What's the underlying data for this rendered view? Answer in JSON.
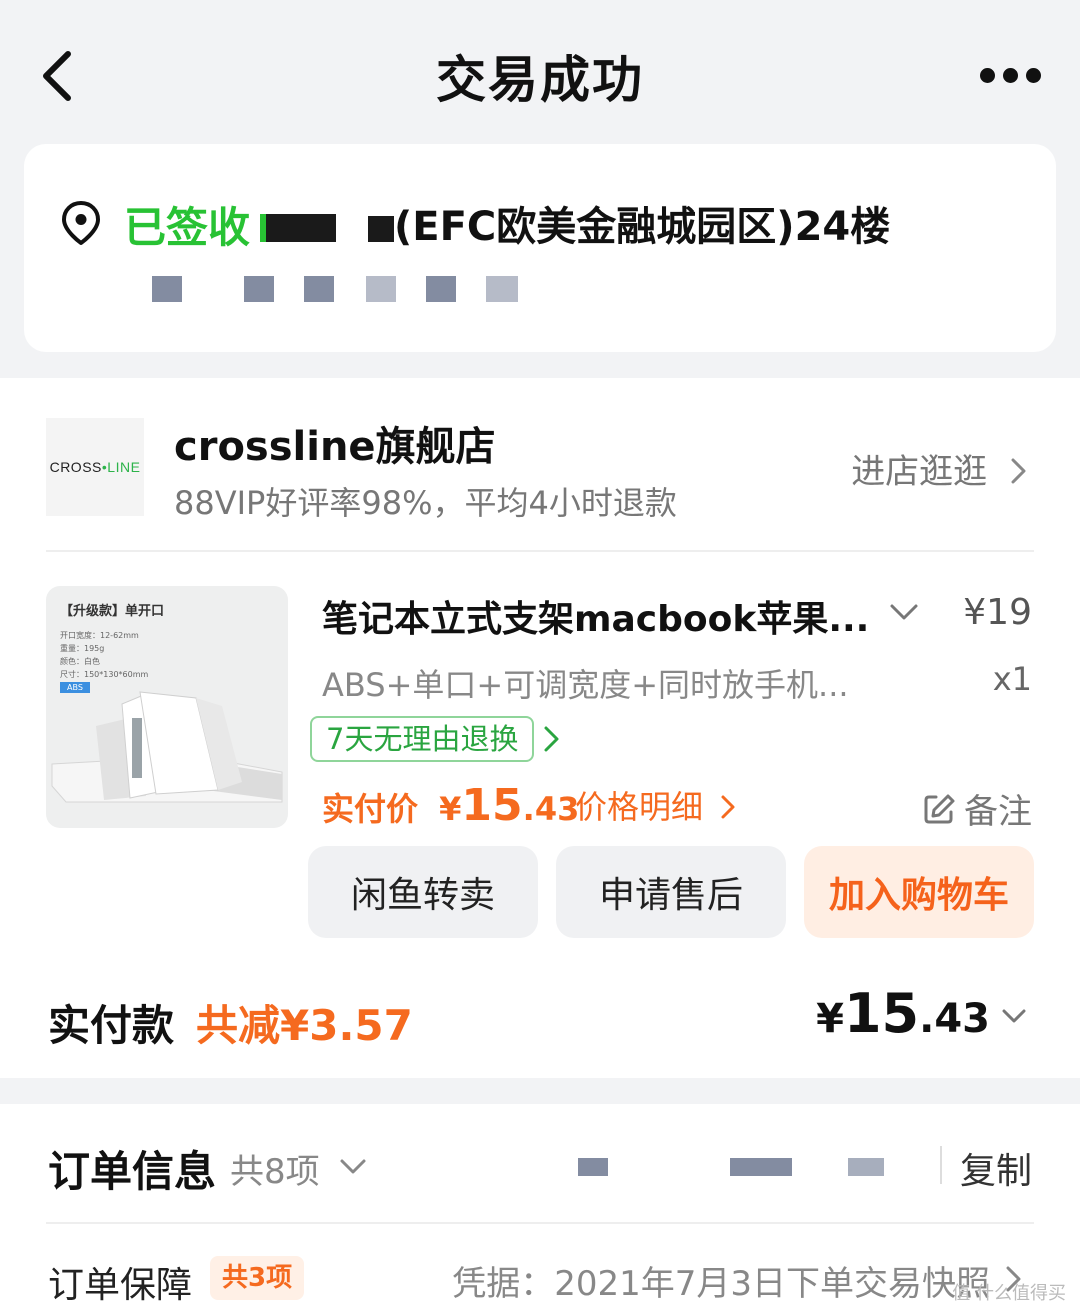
{
  "header": {
    "title": "交易成功",
    "back_icon": "chevron-left-icon",
    "more_icon": "more-dots-icon"
  },
  "address": {
    "status": "已签收",
    "text": "(EFC欧美金融城园区)24楼",
    "status_color": "#28c234"
  },
  "shop": {
    "logo_text_a": "CROSS",
    "logo_text_b": "LINE",
    "name": "crossline旗舰店",
    "subtitle": "88VIP好评率98%，平均4小时退款",
    "visit_label": "进店逛逛"
  },
  "product": {
    "image_title": "【升级款】单开口",
    "image_specs": [
      "开口宽度：12-62mm",
      "重量：195g",
      "颜色：白色",
      "尺寸：150*130*60mm"
    ],
    "image_tag": "ABS",
    "title": "笔记本立式支架macbook苹果...",
    "price": "¥19",
    "sku": "ABS+单口+可调宽度+同时放手机...",
    "quantity": "x1",
    "return_policy": "7天无理由退换",
    "paid_label": "实付价",
    "paid_currency": "¥",
    "paid_int": "15",
    "paid_dec": ".43",
    "price_detail_label": "价格明细",
    "note_label": "备注"
  },
  "actions": {
    "resell": "闲鱼转卖",
    "after_sale": "申请售后",
    "add_cart": "加入购物车"
  },
  "total": {
    "label": "实付款",
    "saved": "共减¥3.57",
    "currency": "¥",
    "amount_int": "15",
    "amount_dec": ".43"
  },
  "order_info": {
    "title": "订单信息",
    "count": "共8项",
    "copy_label": "复制",
    "guarantee_label": "订单保障",
    "guarantee_badge": "共3项",
    "proof": "凭据：2021年7月3日下单交易快照",
    "watermark": "值 什么值得买"
  },
  "colors": {
    "accent_orange": "#f56a1f",
    "success_green": "#28c234"
  }
}
